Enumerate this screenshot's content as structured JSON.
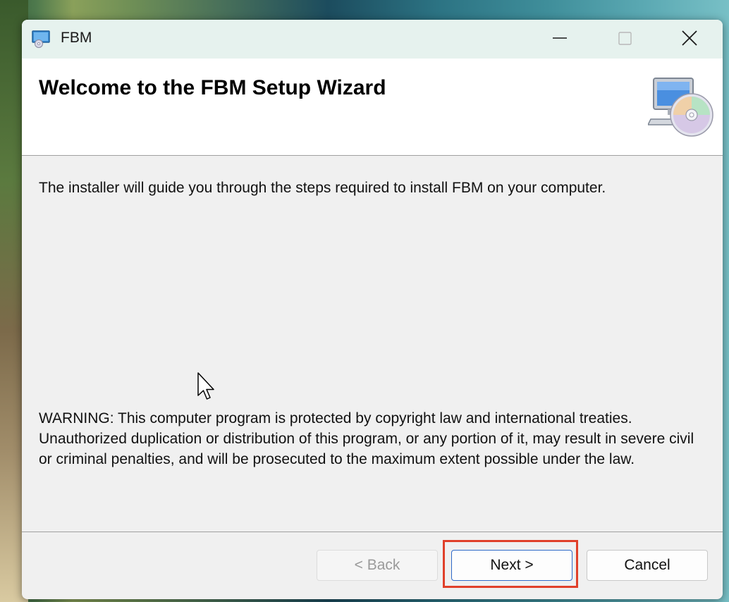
{
  "window": {
    "title": "FBM",
    "controls": {
      "minimize": "minimize-icon",
      "maximize": "maximize-icon",
      "close": "close-icon"
    }
  },
  "header": {
    "title": "Welcome to the FBM Setup Wizard",
    "icon": "computer-cd-icon"
  },
  "content": {
    "intro": "The installer will guide you through the steps required to install FBM on your computer.",
    "warning": "WARNING: This computer program is protected by copyright law and international treaties. Unauthorized duplication or distribution of this program, or any portion of it, may result in severe civil or criminal penalties, and will be prosecuted to the maximum extent possible under the law."
  },
  "buttons": {
    "back": "< Back",
    "back_enabled": false,
    "next": "Next >",
    "cancel": "Cancel"
  },
  "colors": {
    "highlight": "#e0402a",
    "titlebar": "#e6f2ee",
    "default_button_border": "#2f6ac8"
  }
}
